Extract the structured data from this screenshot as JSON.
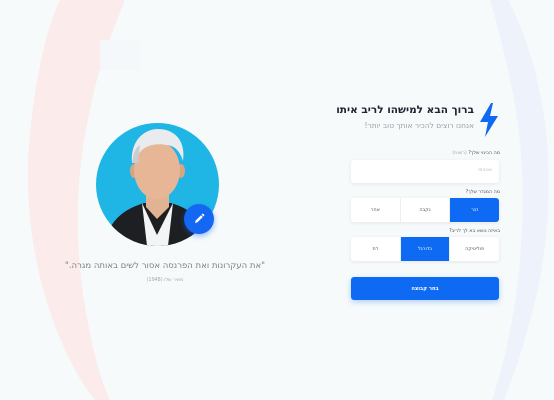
{
  "colors": {
    "accent": "#0f6af3",
    "portrait_bg": "#1fb6e6",
    "page_bg": "#f6fafb"
  },
  "quote": {
    "text": "\"את העקרונות ואת הפרנסה אסור לשים באותה מגרה.\"",
    "author": "מאיר שלו (1948)"
  },
  "header": {
    "logo_icon": "lightning-bolt-icon",
    "title": "ברוך הבא למישהו לריב איתו",
    "subtitle": "אנחנו רוצים להכיר אותך טוב יותר!"
  },
  "form": {
    "name": {
      "label": "מה הכינוי שלך?",
      "optional": "(רשות)",
      "placeholder": "אנונימי",
      "value": ""
    },
    "gender": {
      "label": "מה המגדר שלך?",
      "options": [
        "זכר",
        "נקבה",
        "אחר"
      ],
      "selected": "זכר"
    },
    "topic": {
      "label": "באיזה נושא בא לך לריב?",
      "options": [
        "פוליטיקה",
        "כדורגל",
        "דת"
      ],
      "selected": "כדורגל"
    },
    "submit_label": "בחר קבוצה"
  }
}
